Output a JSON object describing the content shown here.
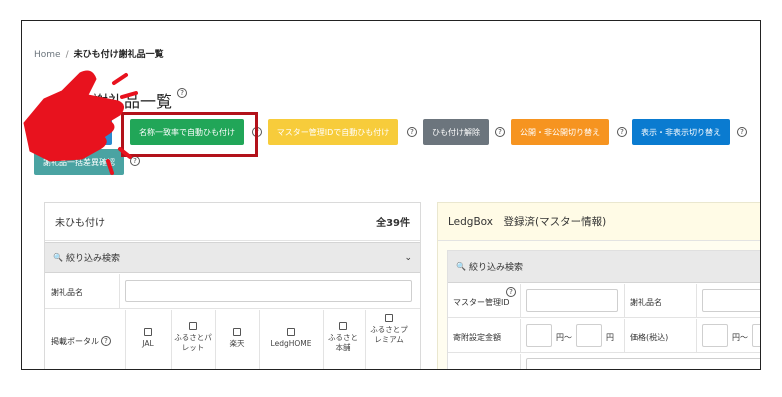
{
  "breadcrumb": {
    "home": "Home",
    "separator": "/",
    "current": "未ひも付け謝礼品一覧"
  },
  "page": {
    "title": "付け謝礼品一覧",
    "help": "?"
  },
  "toolbar": {
    "auto_match_label": "名称一致率で自動ひも付け",
    "master_id_label": "マスター管理IDで自動ひも付け",
    "unlink_label": "ひも付け解除",
    "publish_toggle_label": "公開・非公開切り替え",
    "visibility_toggle_label": "表示・非表示切り替え",
    "bulk_diff_label": "謝礼品一括差異確認",
    "help": "?"
  },
  "left_panel": {
    "title": "未ひも付け",
    "count": "全39件",
    "search_label": "絞り込み検索",
    "name_label": "謝礼品名",
    "portal_label": "掲載ポータル",
    "portals": [
      "JAL",
      "ふるさとパレット",
      "楽天",
      "LedgHOME",
      "ふるさと本舗",
      "ふるさとプレミアム"
    ]
  },
  "right_panel": {
    "title": "LedgBox　登録済(マスター情報)",
    "search_label": "絞り込み検索",
    "master_id_label": "マスター管理ID",
    "name_label": "謝礼品名",
    "donation_label": "寄附設定金額",
    "price_label": "価格(税込)",
    "yen_from": "円〜",
    "yen": "円",
    "help": "?"
  },
  "colors": {
    "green": "#21a658",
    "yellow": "#f7cc3b",
    "gray": "#6c757d",
    "orange": "#f69420",
    "blue": "#0a7bd0",
    "teal": "#4aa3a2",
    "highlight": "#b2111a",
    "pointer": "#e8121e"
  }
}
